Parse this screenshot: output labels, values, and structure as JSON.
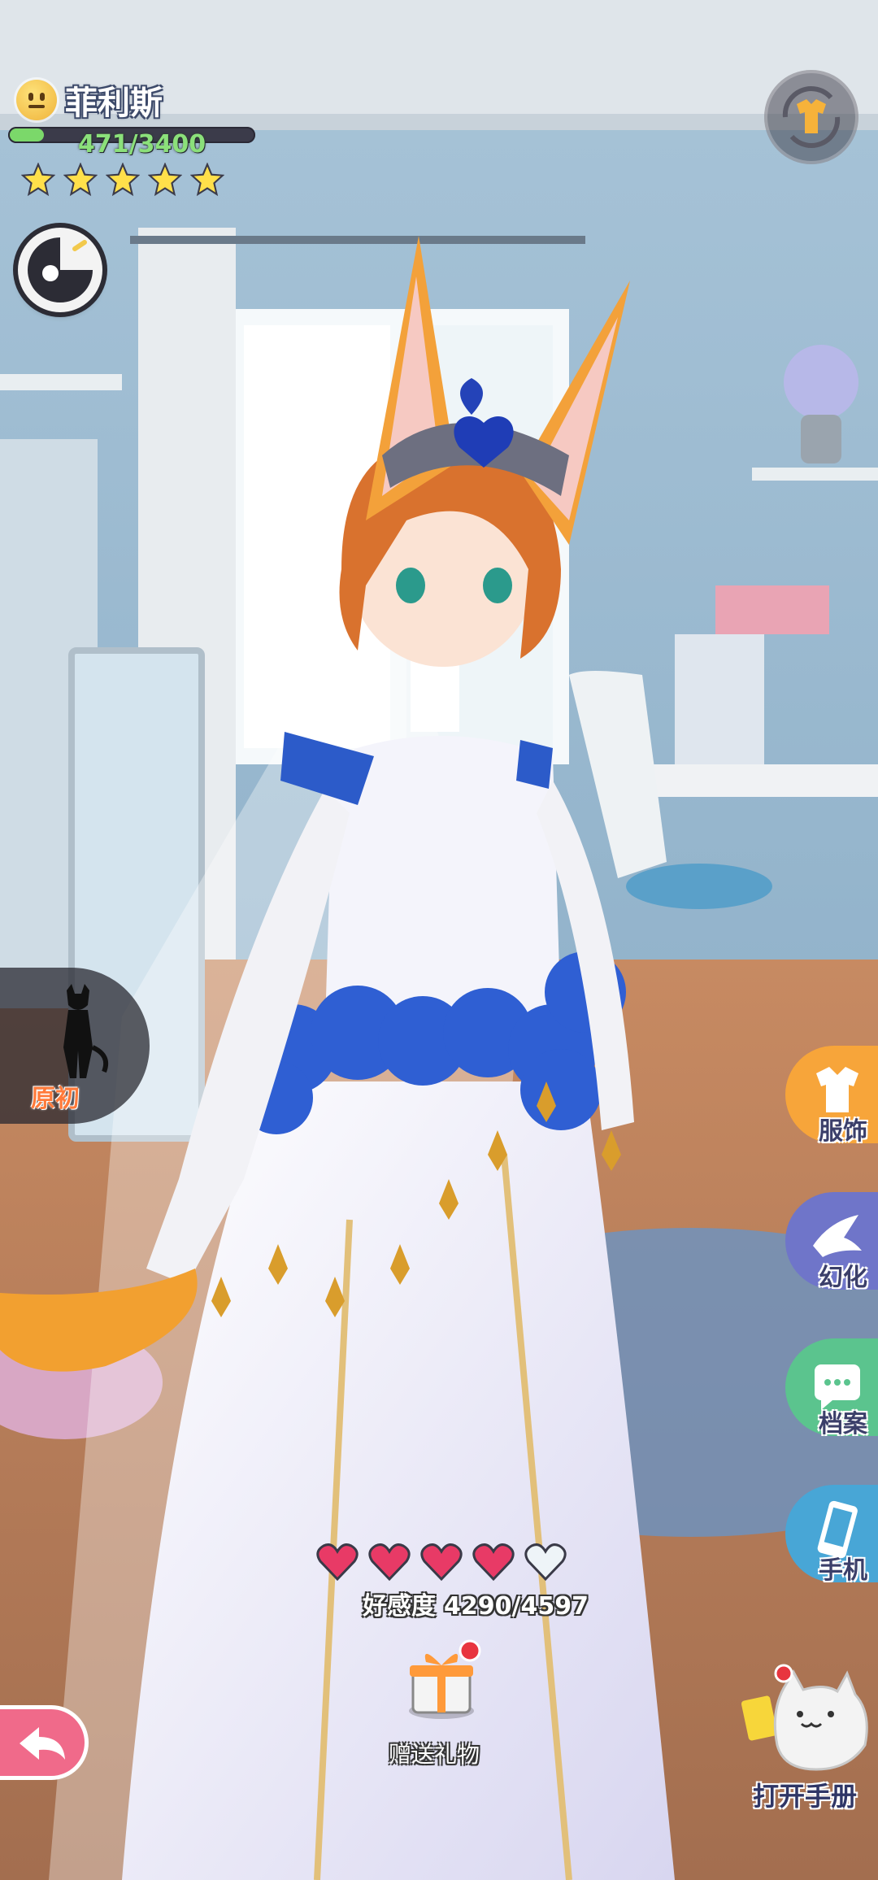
{
  "character": {
    "name": "菲利斯",
    "exp_text": "471/3400",
    "exp_current": 471,
    "exp_max": 3400,
    "star_count": 5,
    "mood_icon": "smiley-face-icon"
  },
  "top_right": {
    "icon": "outfit-swap-icon"
  },
  "left_menu": {
    "origin_label": "原初"
  },
  "right_menu": {
    "items": [
      {
        "label": "服饰",
        "icon": "clothing-icon",
        "color": "#f7a53a"
      },
      {
        "label": "幻化",
        "icon": "dove-icon",
        "color": "#6f75c9"
      },
      {
        "label": "档案",
        "icon": "chat-file-icon",
        "color": "#5bc48e"
      },
      {
        "label": "手机",
        "icon": "phone-icon",
        "color": "#48a6d6"
      }
    ]
  },
  "affection": {
    "label": "好感度",
    "value_text": "4290/4597",
    "hearts_filled": 4,
    "hearts_total": 5
  },
  "gift": {
    "label": "赠送礼物",
    "icon": "gift-box-icon"
  },
  "back": {
    "icon": "back-arrow-icon"
  },
  "handbook": {
    "label": "打开手册",
    "icon": "cat-handbook-icon"
  },
  "colors": {
    "heart": "#e83a66",
    "exp_fill": "#7bd86a",
    "back": "#f06a8a"
  }
}
